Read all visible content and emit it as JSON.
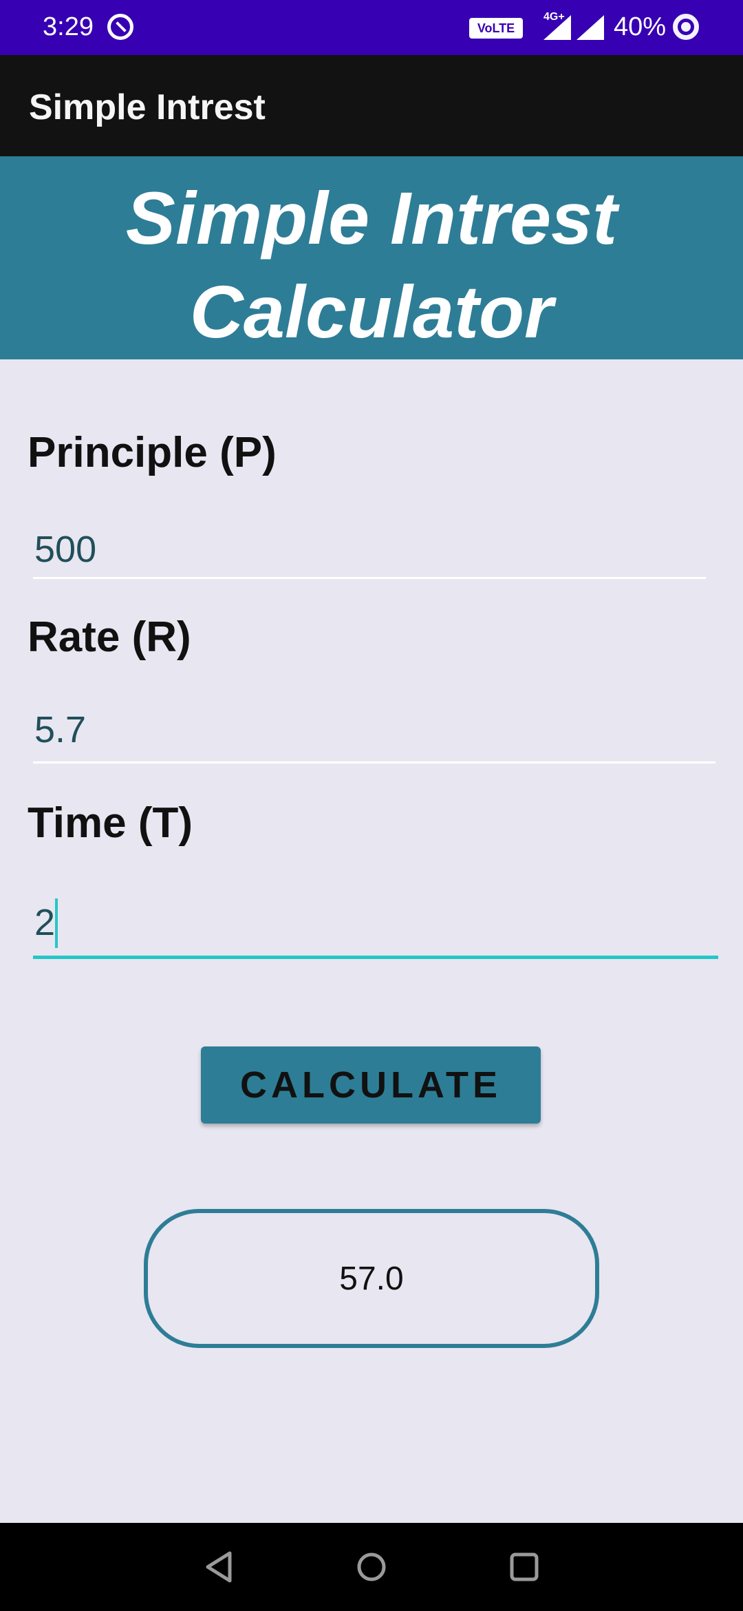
{
  "status_bar": {
    "time": "3:29",
    "volte": "VoLTE",
    "network": "4G+",
    "battery": "40%",
    "color": "#3700b3"
  },
  "app_bar": {
    "title": "Simple Intrest"
  },
  "banner": {
    "title": "Simple Intrest Calculator",
    "color": "#2e7d96"
  },
  "form": {
    "principle_label": "Principle (P)",
    "principle_value": "500",
    "rate_label": "Rate (R)",
    "rate_value": "5.7",
    "time_label": "Time (T)",
    "time_value": "2",
    "accent_color": "#26c6c6"
  },
  "calculate_button": {
    "label": "CALCULATE"
  },
  "result": {
    "value": "57.0"
  },
  "nav_bar": {
    "icons": [
      "back-icon",
      "home-icon",
      "recents-icon"
    ]
  }
}
